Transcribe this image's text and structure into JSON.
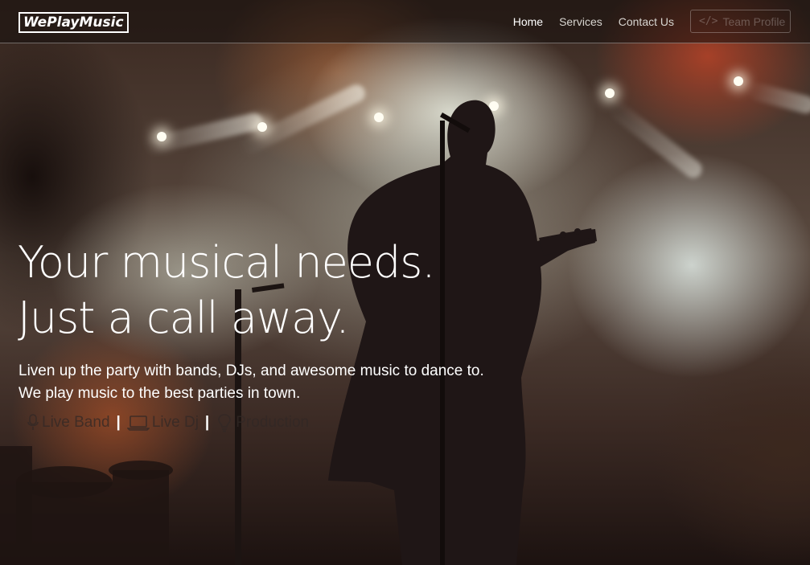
{
  "navbar": {
    "logo_text": "WePlayMusic",
    "links": [
      {
        "label": "Home",
        "active": true
      },
      {
        "label": "Services",
        "active": false
      },
      {
        "label": "Contact Us",
        "active": false
      }
    ],
    "profile_button": {
      "label": "Team Profile",
      "icon": "code-icon"
    }
  },
  "hero": {
    "headline_line1": "Your musical needs.",
    "headline_line2": "Just a call away.",
    "tagline_line1": "Liven up the party with bands, DJs, and awesome music to dance to.",
    "tagline_line2": "We play music to the best parties in town.",
    "services": [
      {
        "label": "Live Band",
        "icon": "microphone-icon"
      },
      {
        "label": "Live Dj",
        "icon": "laptop-icon"
      },
      {
        "label": "Production",
        "icon": "lightbulb-icon"
      }
    ],
    "separator": "|"
  },
  "colors": {
    "text_primary": "#ffffff",
    "nav_inactive": "#d8d5d0"
  }
}
